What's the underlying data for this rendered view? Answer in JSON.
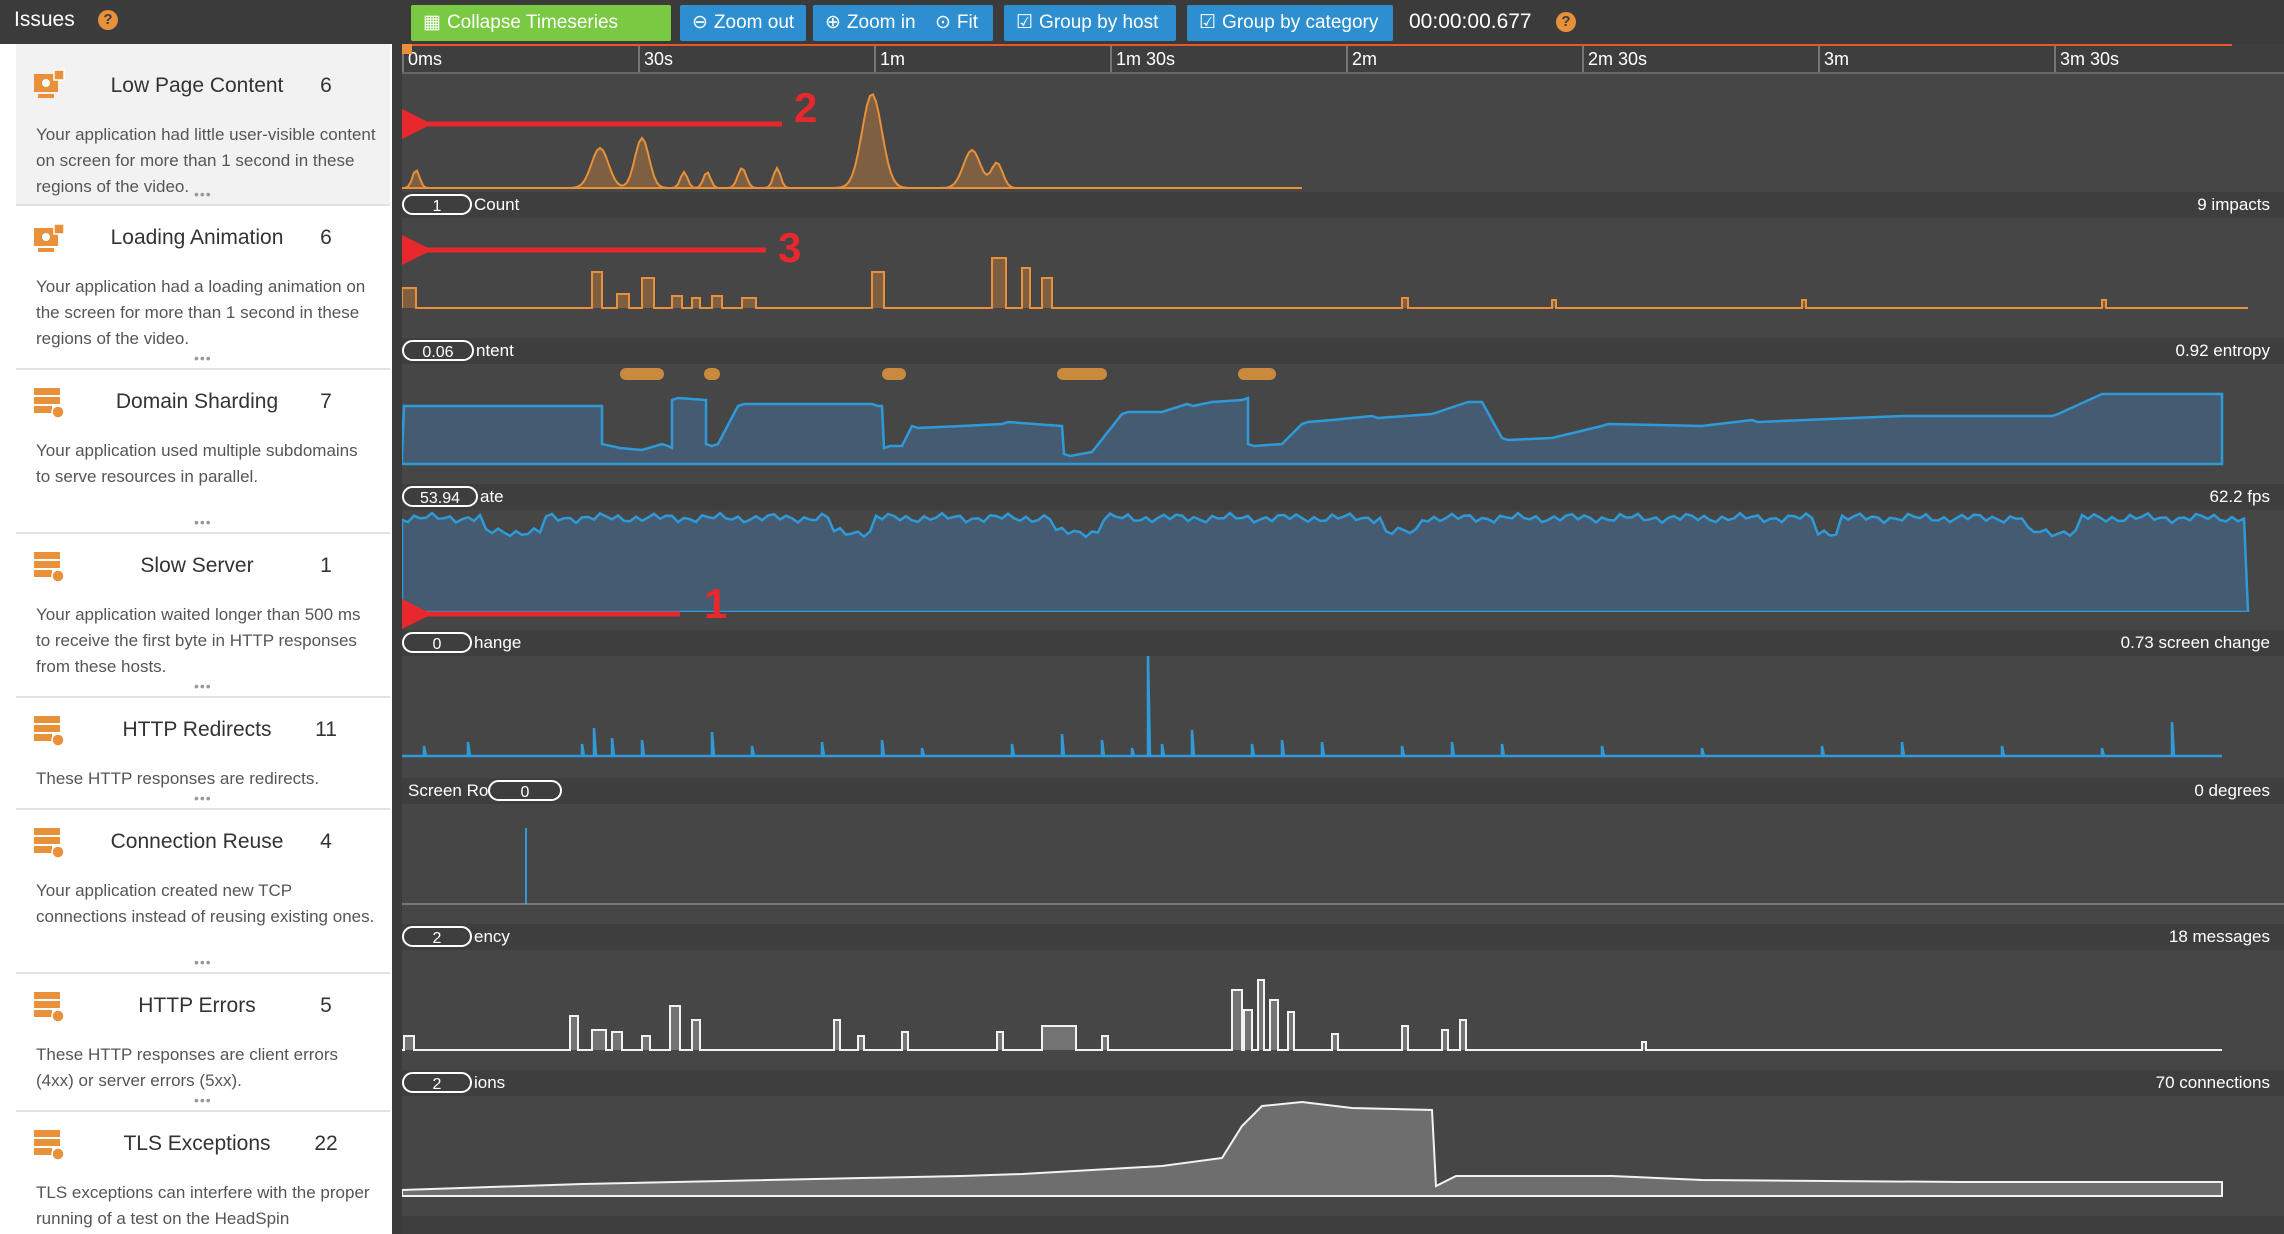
{
  "header": {
    "issues_title": "Issues",
    "help_glyph": "?",
    "buttons": {
      "collapse": "Collapse Timeseries",
      "zoom_out": "Zoom out",
      "zoom_in": "Zoom in",
      "fit": "Fit",
      "group_host": "Group by host",
      "group_category": "Group by category"
    },
    "time": "00:00:00.677"
  },
  "sidebar": {
    "issues": [
      {
        "name": "Low Page Content",
        "count": "6",
        "icon": "screen-issue-icon",
        "desc": "Your application had little user-visible content on screen for more than 1 second in these regions of the video."
      },
      {
        "name": "Loading Animation",
        "count": "6",
        "icon": "screen-issue-icon",
        "desc": "Your application had a loading animation on the screen for more than 1 second in these regions of the video."
      },
      {
        "name": "Domain Sharding",
        "count": "7",
        "icon": "server-issue-icon",
        "desc": "Your application used multiple subdomains to serve resources in parallel."
      },
      {
        "name": "Slow Server",
        "count": "1",
        "icon": "server-issue-icon",
        "desc": "Your application waited longer than 500 ms to receive the first byte in HTTP responses from these hosts."
      },
      {
        "name": "HTTP Redirects",
        "count": "11",
        "icon": "server-issue-icon",
        "desc": "These HTTP responses are redirects."
      },
      {
        "name": "Connection Reuse",
        "count": "4",
        "icon": "server-issue-icon",
        "desc": "Your application created new TCP connections instead of reusing existing ones."
      },
      {
        "name": "HTTP Errors",
        "count": "5",
        "icon": "server-issue-icon",
        "desc": "These HTTP responses are client errors (4xx) or server errors (5xx)."
      },
      {
        "name": "TLS Exceptions",
        "count": "22",
        "icon": "server-issue-icon",
        "desc": "TLS exceptions can interfere with the proper running of a test on the HeadSpin"
      }
    ],
    "more_glyph": "•••"
  },
  "ruler": {
    "ticks": [
      "0ms",
      "30s",
      "1m",
      "1m 30s",
      "2m",
      "2m 30s",
      "3m",
      "3m 30s"
    ]
  },
  "tracks": [
    {
      "pill": "",
      "label": "",
      "unit": ""
    },
    {
      "pill": "1",
      "label": "Count",
      "unit": "9 impacts"
    },
    {
      "pill": "0.06",
      "label": "ntent",
      "unit": "0.92 entropy"
    },
    {
      "pill": "53.94",
      "label": "ate",
      "unit": "62.2 fps"
    },
    {
      "pill": "0",
      "label": "hange",
      "unit": "0.73 screen change"
    },
    {
      "pill": "0",
      "label": "Screen Ro",
      "unit": "0 degrees"
    },
    {
      "pill": "2",
      "label": "ency",
      "unit": "18 messages"
    },
    {
      "pill": "2",
      "label": "ions",
      "unit": "70 connections"
    }
  ],
  "annotations": [
    "1",
    "2",
    "3"
  ],
  "colors": {
    "orange": "#e8903a",
    "blue": "#2e9ad8",
    "green": "#7ac943",
    "button_blue": "#2e8fd0",
    "white_series": "#f2f2f2"
  }
}
